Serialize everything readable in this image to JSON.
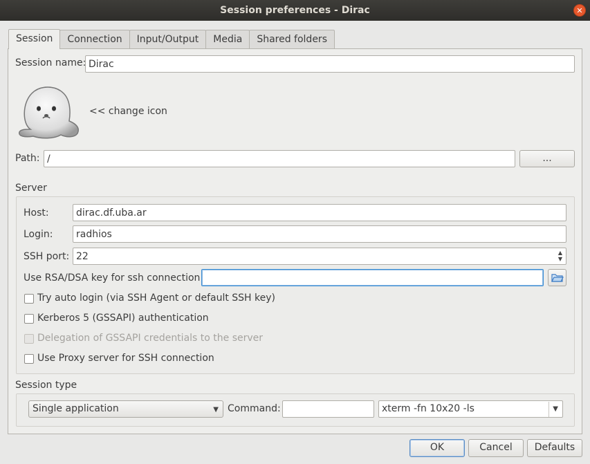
{
  "window": {
    "title": "Session preferences - Dirac"
  },
  "tabs": [
    {
      "label": "Session",
      "active": true
    },
    {
      "label": "Connection",
      "active": false
    },
    {
      "label": "Input/Output",
      "active": false
    },
    {
      "label": "Media",
      "active": false
    },
    {
      "label": "Shared folders",
      "active": false
    }
  ],
  "session": {
    "name_label": "Session name:",
    "name_value": "Dirac",
    "change_icon_label": "<< change icon",
    "path_label": "Path:",
    "path_value": "/",
    "path_browse_label": "..."
  },
  "server": {
    "title": "Server",
    "host_label": "Host:",
    "host_value": "dirac.df.uba.ar",
    "login_label": "Login:",
    "login_value": "radhios",
    "ssh_port_label": "SSH port:",
    "ssh_port_value": "22",
    "rsa_key_label": "Use RSA/DSA key for ssh connection:",
    "rsa_key_value": "",
    "checkboxes": [
      {
        "label": "Try auto login (via SSH Agent or default SSH key)",
        "checked": false,
        "enabled": true
      },
      {
        "label": "Kerberos 5 (GSSAPI) authentication",
        "checked": false,
        "enabled": true
      },
      {
        "label": "Delegation of GSSAPI credentials to the server",
        "checked": false,
        "enabled": false
      },
      {
        "label": "Use Proxy server for SSH connection",
        "checked": false,
        "enabled": true
      }
    ]
  },
  "session_type": {
    "title": "Session type",
    "selected": "Single application",
    "command_label": "Command:",
    "command_value": "",
    "command_combo_value": "xterm -fn 10x20 -ls"
  },
  "buttons": {
    "ok": "OK",
    "cancel": "Cancel",
    "defaults": "Defaults"
  },
  "icons": {
    "close": "close-icon",
    "session_icon": "seal-icon",
    "folder": "folder-open-icon",
    "dropdown": "chevron-down-icon"
  },
  "colors": {
    "titlebar": "#2e2d2a",
    "close": "#e6582c",
    "focus": "#3d8ed4"
  }
}
